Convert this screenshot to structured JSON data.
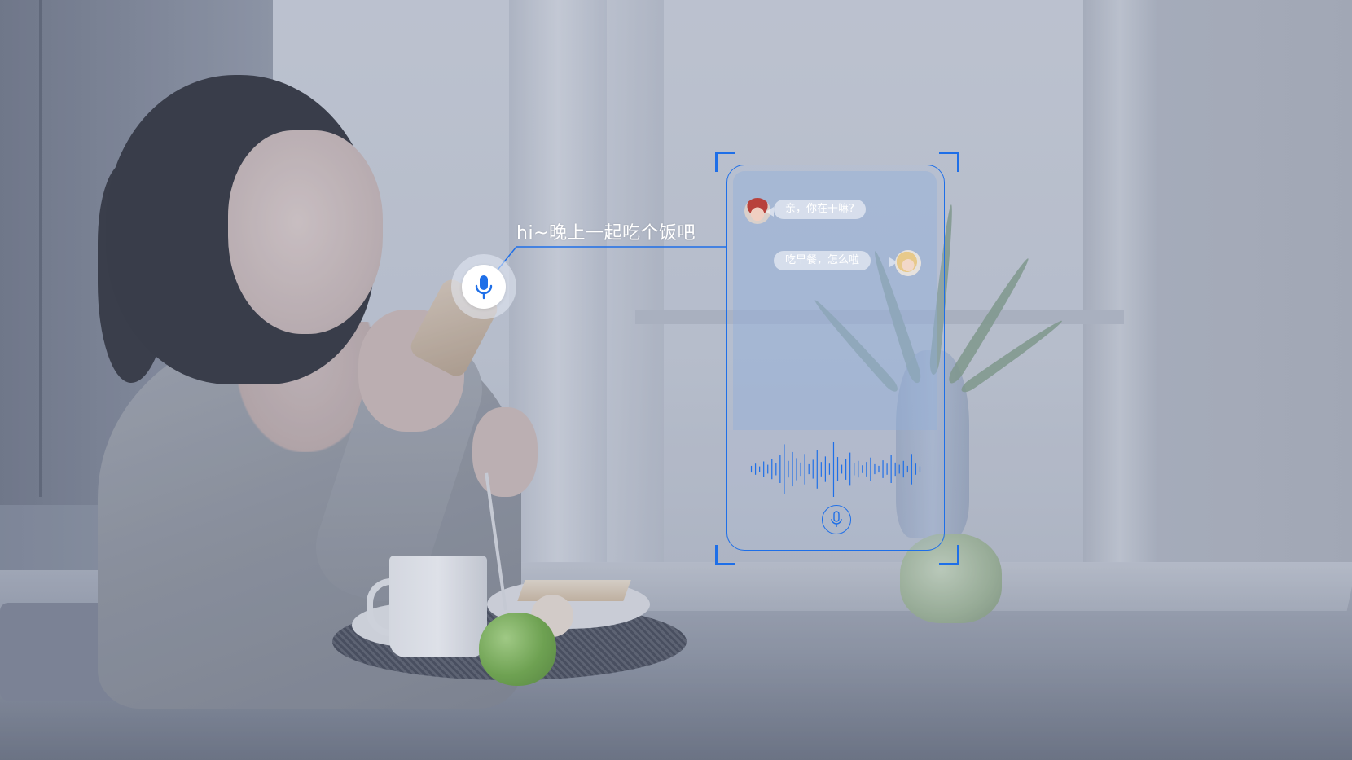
{
  "voice_prompt": {
    "text": "hi~晚上一起吃个饭吧"
  },
  "chat": {
    "messages": [
      {
        "side": "left",
        "text": "亲，你在干嘛?",
        "avatar": "avatar-red-hat"
      },
      {
        "side": "right",
        "text": "吃早餐，怎么啦",
        "avatar": "avatar-blonde"
      }
    ]
  },
  "icons": {
    "large_mic": "microphone-icon",
    "small_mic": "microphone-icon"
  },
  "colors": {
    "accent": "#1e6fe8",
    "mic_icon": "#1e6fe8",
    "panel_tint": "#8caad7"
  },
  "waveform": {
    "levels": [
      0.12,
      0.2,
      0.1,
      0.28,
      0.16,
      0.36,
      0.22,
      0.5,
      0.9,
      0.3,
      0.62,
      0.4,
      0.24,
      0.55,
      0.18,
      0.34,
      0.7,
      0.26,
      0.46,
      0.2,
      1.0,
      0.44,
      0.16,
      0.38,
      0.6,
      0.22,
      0.3,
      0.14,
      0.26,
      0.42,
      0.18,
      0.12,
      0.32,
      0.2,
      0.5,
      0.24,
      0.16,
      0.3,
      0.12,
      0.55,
      0.2,
      0.1
    ]
  }
}
